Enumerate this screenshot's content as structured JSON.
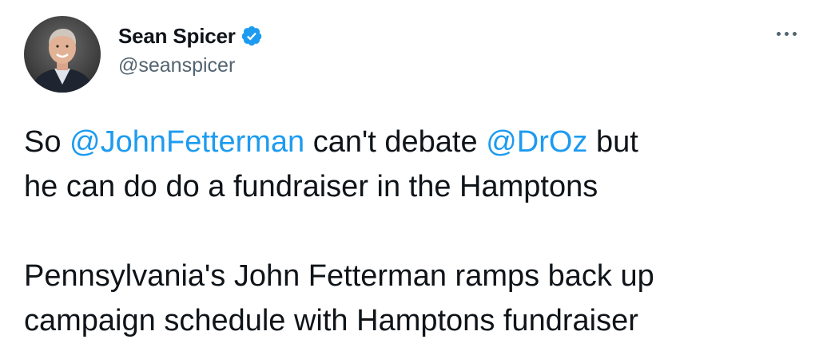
{
  "author": {
    "display_name": "Sean Spicer",
    "handle": "@seanspicer",
    "verified": true
  },
  "tweet": {
    "line1": {
      "t1": "So ",
      "mention1": "@JohnFetterman",
      "t2": " can't debate ",
      "mention2": "@DrOz",
      "t3": " but"
    },
    "line2": "he can do do a fundraiser in the Hamptons",
    "headline_line1": "Pennsylvania's John Fetterman ramps back up",
    "headline_line2": "campaign schedule with Hamptons fundraiser"
  },
  "icons": {
    "verified": "verified-badge-icon",
    "more": "more-options-icon"
  },
  "colors": {
    "mention": "#1d9bf0",
    "text": "#0f1419",
    "secondary": "#536471",
    "verified": "#1d9bf0"
  }
}
